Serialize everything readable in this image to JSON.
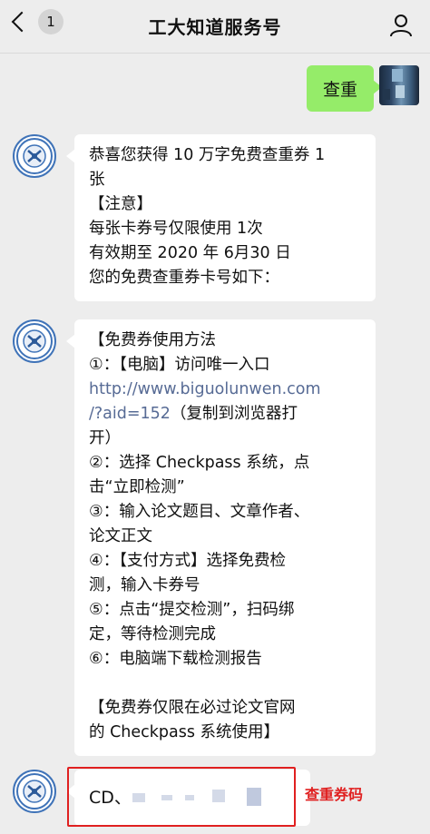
{
  "header": {
    "back_badge": "1",
    "title": "工大知道服务号"
  },
  "messages": {
    "user_msg": "查重",
    "msg1": {
      "lines": [
        "恭喜您获得 10 万字免费查重券 1",
        "张",
        "【注意】",
        "每张卡券号仅限使用 1次",
        "有效期至 2020 年 6月30 日",
        "您的免费查重券卡号如下："
      ]
    },
    "msg2": {
      "lines": [
        "【免费券使用方法",
        "①：【电脑】访问唯一入口",
        "http://www.biguolunwen.com",
        "/?aid=152（复制到浏览器打",
        "开）",
        "②：选择 Checkpass 系统，点",
        "击“立即检测”",
        "③：输入论文题目、文章作者、",
        "论文正文",
        "④：【支付方式】选择免费检",
        "测，输入卡券号",
        "⑤：点击“提交检测”，扫码绑",
        "定，等待检测完成",
        "⑥：电脑端下载检测报告",
        "",
        "【免费券仅限在必过论文官网",
        "的 Checkpass 系统使用】"
      ],
      "link_prefix": "http://www.biguolunwen.com",
      "link_suffix": "/?aid=152",
      "link_tail": "（复制到浏览器打"
    },
    "msg3": {
      "code_prefix": "CD、"
    }
  },
  "annotation": "查重券码",
  "colors": {
    "user_bubble": "#95ec69",
    "highlight": "#e02020",
    "link": "#576b95"
  }
}
